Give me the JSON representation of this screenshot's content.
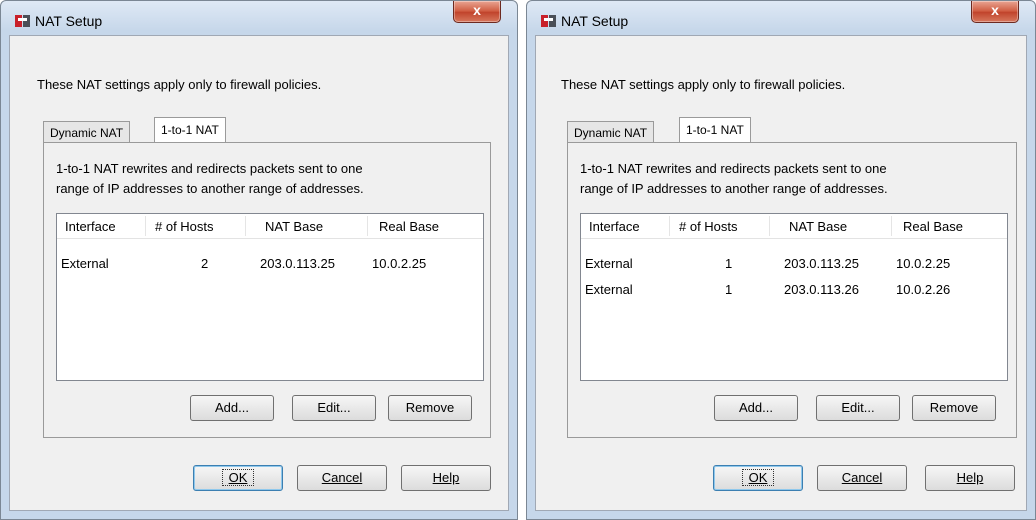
{
  "dialogs": [
    {
      "title": "NAT Setup",
      "close_glyph": "x",
      "intro": "These NAT settings apply only to firewall policies.",
      "tabs": [
        {
          "label": "Dynamic NAT"
        },
        {
          "label": "1-to-1 NAT",
          "active": true
        }
      ],
      "description_lines": [
        "1-to-1 NAT rewrites and redirects packets sent to one",
        "range of IP addresses to another range of addresses."
      ],
      "columns": [
        "Interface",
        "# of Hosts",
        "NAT Base",
        "Real Base"
      ],
      "rows": [
        {
          "interface": "External",
          "hosts": "2",
          "nat_base": "203.0.113.25",
          "real_base": "10.0.2.25"
        }
      ],
      "list_buttons": {
        "add": "Add...",
        "edit": "Edit...",
        "remove": "Remove"
      },
      "footer": {
        "ok": "OK",
        "cancel": "Cancel",
        "help": "Help"
      }
    },
    {
      "title": "NAT Setup",
      "close_glyph": "x",
      "intro": "These NAT settings apply only to firewall policies.",
      "tabs": [
        {
          "label": "Dynamic NAT"
        },
        {
          "label": "1-to-1 NAT",
          "active": true
        }
      ],
      "description_lines": [
        "1-to-1 NAT rewrites and redirects packets sent to one",
        "range of IP addresses to another range of addresses."
      ],
      "columns": [
        "Interface",
        "# of Hosts",
        "NAT Base",
        "Real Base"
      ],
      "rows": [
        {
          "interface": "External",
          "hosts": "1",
          "nat_base": "203.0.113.25",
          "real_base": "10.0.2.25"
        },
        {
          "interface": "External",
          "hosts": "1",
          "nat_base": "203.0.113.26",
          "real_base": "10.0.2.26"
        }
      ],
      "list_buttons": {
        "add": "Add...",
        "edit": "Edit...",
        "remove": "Remove"
      },
      "footer": {
        "ok": "OK",
        "cancel": "Cancel",
        "help": "Help"
      }
    }
  ],
  "colors": {
    "close_button": "#c0422a",
    "frame": "#c6d7ea",
    "client": "#f0f0f0",
    "default_button_border": "#3c7fb1"
  },
  "icons": {
    "app": "watchguard-app-icon",
    "close": "close-icon"
  }
}
